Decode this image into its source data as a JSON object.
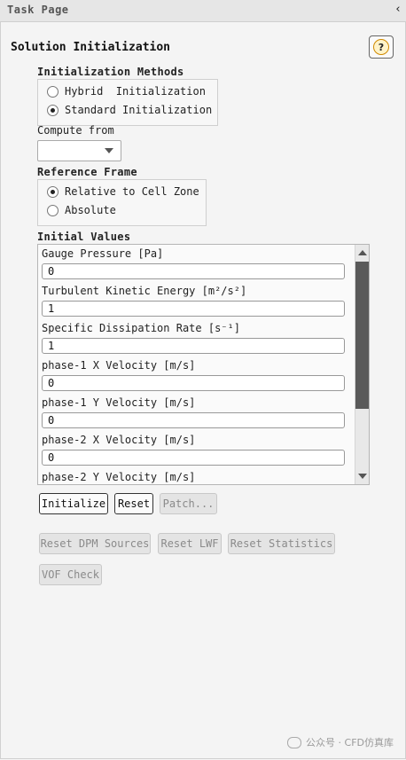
{
  "window": {
    "title": "Task Page",
    "collapse_glyph": "‹"
  },
  "panel": {
    "title": "Solution Initialization",
    "help_glyph": "?"
  },
  "init_methods": {
    "label": "Initialization Methods",
    "options": [
      {
        "label": "Hybrid  Initialization",
        "checked": false
      },
      {
        "label": "Standard Initialization",
        "checked": true
      }
    ]
  },
  "compute_from": {
    "label": "Compute from",
    "selected": ""
  },
  "reference_frame": {
    "label": "Reference Frame",
    "options": [
      {
        "label": "Relative to Cell Zone",
        "checked": true
      },
      {
        "label": "Absolute",
        "checked": false
      }
    ]
  },
  "initial_values": {
    "label": "Initial Values",
    "fields": [
      {
        "label": "Gauge Pressure [Pa]",
        "value": "0"
      },
      {
        "label": "Turbulent Kinetic Energy [m²/s²]",
        "value": "1"
      },
      {
        "label": "Specific Dissipation Rate [s⁻¹]",
        "value": "1"
      },
      {
        "label": "phase-1 X Velocity [m/s]",
        "value": "0"
      },
      {
        "label": "phase-1 Y Velocity [m/s]",
        "value": "0"
      },
      {
        "label": "phase-2 X Velocity [m/s]",
        "value": "0"
      },
      {
        "label": "phase-2 Y Velocity [m/s]",
        "value": ""
      }
    ]
  },
  "buttons": {
    "initialize": "Initialize",
    "reset": "Reset",
    "patch": "Patch...",
    "reset_dpm": "Reset DPM Sources",
    "reset_lwf": "Reset LWF",
    "reset_stats": "Reset Statistics",
    "vof_check": "VOF Check"
  },
  "watermark": {
    "text": "公众号 · CFD仿真库"
  },
  "icons": {
    "help": "help-icon",
    "collapse": "chevron-left-icon",
    "dropdown": "chevron-down-icon",
    "scroll_up": "arrow-up-icon",
    "scroll_down": "arrow-down-icon",
    "watermark": "wechat-icon"
  }
}
